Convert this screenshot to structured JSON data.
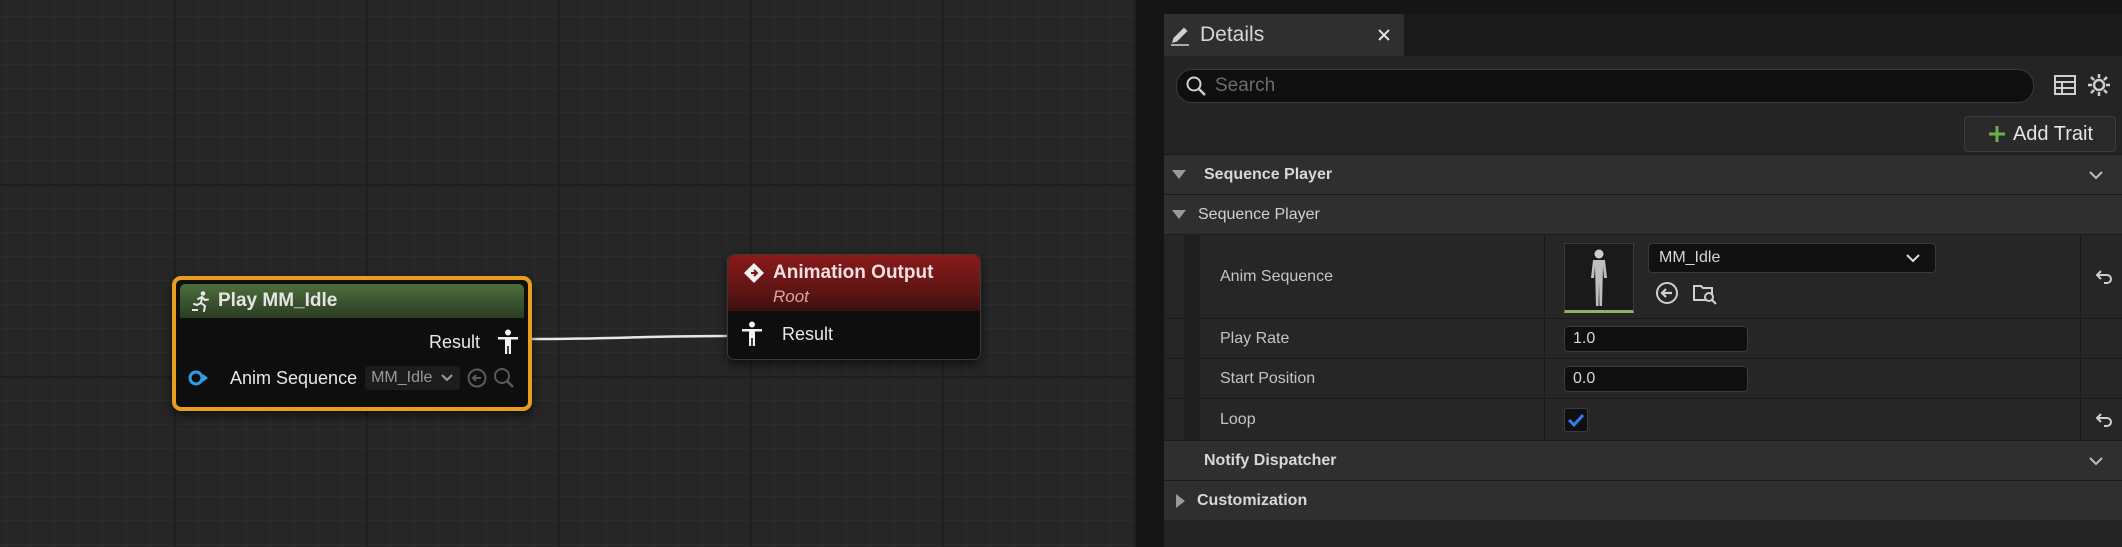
{
  "graph": {
    "play_node": {
      "title": "Play MM_Idle",
      "result_pin": "Result",
      "anim_sequence_pin": "Anim Sequence",
      "anim_sequence_value": "MM_Idle"
    },
    "output_node": {
      "title": "Animation Output",
      "subtitle": "Root",
      "result_pin": "Result"
    }
  },
  "details": {
    "tab_title": "Details",
    "search_placeholder": "Search",
    "add_trait_label": "Add Trait",
    "sections": {
      "sequence_player_trait": "Sequence Player",
      "sequence_player_category": "Sequence Player",
      "notify_dispatcher": "Notify Dispatcher",
      "customization": "Customization"
    },
    "properties": {
      "anim_sequence_label": "Anim Sequence",
      "anim_sequence_value": "MM_Idle",
      "play_rate_label": "Play Rate",
      "play_rate_value": "1.0",
      "start_position_label": "Start Position",
      "start_position_value": "0.0",
      "loop_label": "Loop",
      "loop_checked": true
    }
  },
  "colors": {
    "selection_outline": "#e89d1e",
    "play_node_header": "#4e6e3c",
    "output_node_header": "#8a1a1a",
    "pin_blue": "#2f9de8",
    "checkbox_accent": "#2f80ed",
    "add_icon": "#6ab04c"
  },
  "icons": {
    "play_node": "running-figure-icon",
    "output_node": "diamond-icon",
    "pose_pin": "pose-figure-icon",
    "sequence_pin": "object-pin-icon",
    "tab": "pencil-icon",
    "close": "close-icon",
    "search": "search-icon",
    "table_view": "table-icon",
    "settings": "gear-icon"
  }
}
